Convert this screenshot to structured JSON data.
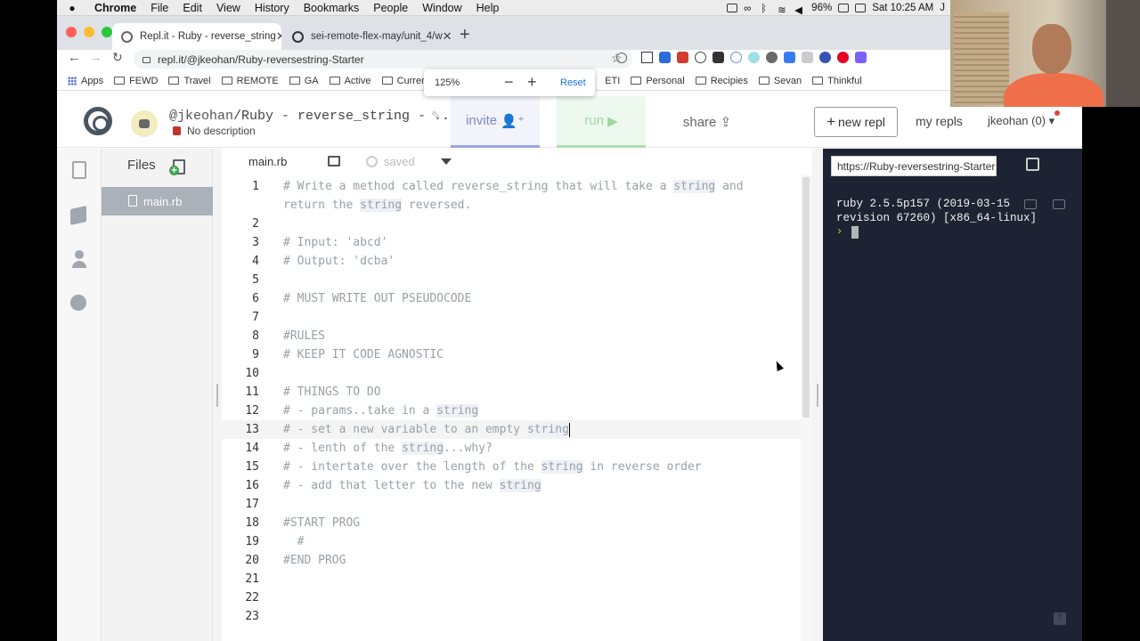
{
  "menubar": {
    "app": "Chrome",
    "items": [
      "File",
      "Edit",
      "View",
      "History",
      "Bookmarks",
      "People",
      "Window",
      "Help"
    ],
    "battery": "96%",
    "clock": "Sat 10:25 AM",
    "user_initial": "J"
  },
  "tabs": [
    {
      "title": "Repl.it - Ruby - reverse_string",
      "active": true
    },
    {
      "title": "sei-remote-flex-may/unit_4/w",
      "active": false
    }
  ],
  "address_bar": {
    "url": "repl.it/@jkeohan/Ruby-reversestring-Starter"
  },
  "bookmarks": [
    {
      "label": "Apps",
      "icon": "apps-grid-icon"
    },
    {
      "label": "FEWD",
      "icon": "folder-icon"
    },
    {
      "label": "Travel",
      "icon": "folder-icon"
    },
    {
      "label": "REMOTE",
      "icon": "folder-icon"
    },
    {
      "label": "GA",
      "icon": "folder-icon"
    },
    {
      "label": "Active",
      "icon": "folder-icon"
    },
    {
      "label": "Curren",
      "icon": "folder-icon"
    },
    {
      "label": "ETI",
      "icon": "folder-icon"
    },
    {
      "label": "Personal",
      "icon": "folder-icon"
    },
    {
      "label": "Recipies",
      "icon": "folder-icon"
    },
    {
      "label": "Sevan",
      "icon": "folder-icon"
    },
    {
      "label": "Thinkful",
      "icon": "folder-icon"
    }
  ],
  "zoom_popup": {
    "level": "125%",
    "minus": "−",
    "plus": "+",
    "reset": "Reset"
  },
  "repl": {
    "owner": "@jkeohan",
    "name": "/Ruby - reverse_string - ...",
    "description": "No description",
    "invite": "invite",
    "run": "run",
    "share": "share",
    "new_repl": "new repl",
    "my_repls": "my repls",
    "user": "jkeohan (0)"
  },
  "files_panel": {
    "title": "Files",
    "files": [
      "main.rb"
    ]
  },
  "editor": {
    "filename": "main.rb",
    "status": "saved",
    "current_line": 13,
    "lines": [
      {
        "n": "1",
        "text": "# Write a method called reverse_string that will take a string and"
      },
      {
        "n": "",
        "text": "return the string reversed."
      },
      {
        "n": "2",
        "text": ""
      },
      {
        "n": "3",
        "text": "# Input: 'abcd'"
      },
      {
        "n": "4",
        "text": "# Output: 'dcba'"
      },
      {
        "n": "5",
        "text": ""
      },
      {
        "n": "6",
        "text": "# MUST WRITE OUT PSEUDOCODE"
      },
      {
        "n": "7",
        "text": ""
      },
      {
        "n": "8",
        "text": "#RULES"
      },
      {
        "n": "9",
        "text": "# KEEP IT CODE AGNOSTIC"
      },
      {
        "n": "10",
        "text": ""
      },
      {
        "n": "11",
        "text": "# THINGS TO DO"
      },
      {
        "n": "12",
        "text": "# - params..take in a string"
      },
      {
        "n": "13",
        "text": "# - set a new variable to an empty string"
      },
      {
        "n": "14",
        "text": "# - lenth of the string...why?"
      },
      {
        "n": "15",
        "text": "# - intertate over the length of the string in reverse order"
      },
      {
        "n": "16",
        "text": "# - add that letter to the new string"
      },
      {
        "n": "17",
        "text": ""
      },
      {
        "n": "18",
        "text": "#START PROG"
      },
      {
        "n": "19",
        "text": "  #"
      },
      {
        "n": "20",
        "text": "#END PROG"
      },
      {
        "n": "21",
        "text": ""
      },
      {
        "n": "22",
        "text": ""
      },
      {
        "n": "23",
        "text": ""
      }
    ]
  },
  "console": {
    "url": "https://Ruby-reversestring-Starter.",
    "output": "ruby 2.5.5p157 (2019-03-15\nrevision 67260) [x86_64-linux]",
    "prompt": "›",
    "help": "?"
  },
  "colors": {
    "invite": "#7c86c9",
    "run": "#9ed6a0",
    "console_bg": "#1d2333",
    "selected_file": "#aab1b8"
  }
}
